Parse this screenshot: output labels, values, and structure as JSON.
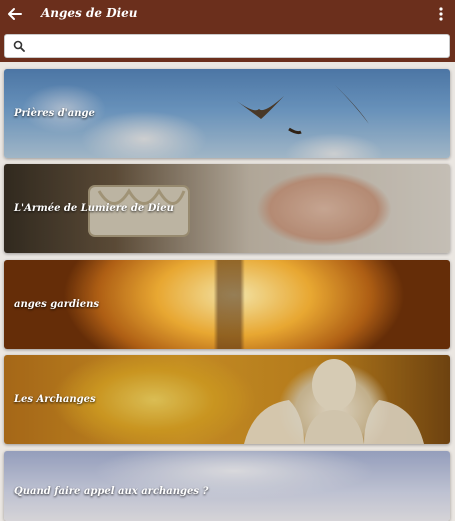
{
  "appbar": {
    "title": "Anges de Dieu",
    "back_icon": "arrow-left-icon",
    "menu_icon": "more-vert-icon",
    "color": "#6b2f1c"
  },
  "search": {
    "icon": "search-icon",
    "placeholder": "",
    "value": ""
  },
  "items": [
    {
      "label": "Prières d'ange",
      "image": "doves-in-sky"
    },
    {
      "label": "L'Armée de Lumiere de Dieu",
      "image": "praying-hands"
    },
    {
      "label": "anges gardiens",
      "image": "cross-sunset"
    },
    {
      "label": "Les Archanges",
      "image": "angel-statue"
    },
    {
      "label": "Quand faire appel aux archanges ?",
      "image": "clouds"
    }
  ]
}
